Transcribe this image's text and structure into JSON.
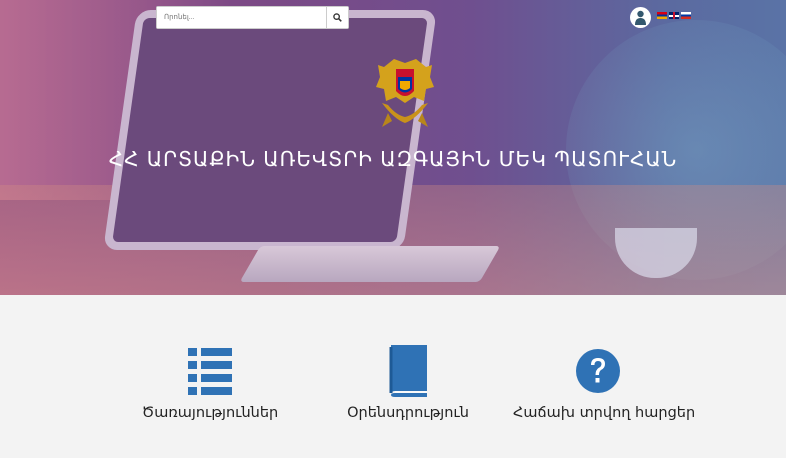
{
  "search": {
    "placeholder": "Որոնել...",
    "icon": "search-icon"
  },
  "header": {
    "user_icon": "user-icon",
    "languages": [
      "hy",
      "en",
      "ru"
    ]
  },
  "hero": {
    "title": "ՀՀ ԱՐՏԱՔԻՆ ԱՌԵՎՏՐԻ ԱԶԳԱՅԻՆ ՄԵԿ ՊԱՏՈՒՀԱՆ",
    "emblem": "armenia-coat-of-arms"
  },
  "features": [
    {
      "label": "Ծառայություններ",
      "icon": "list-icon"
    },
    {
      "label": "Օրենսդրություն",
      "icon": "book-icon"
    },
    {
      "label": "Հաճախ տրվող հարցեր",
      "icon": "question-circle-icon"
    }
  ],
  "colors": {
    "accent": "#2f72b5",
    "hero_purple": "#7a4a86"
  }
}
